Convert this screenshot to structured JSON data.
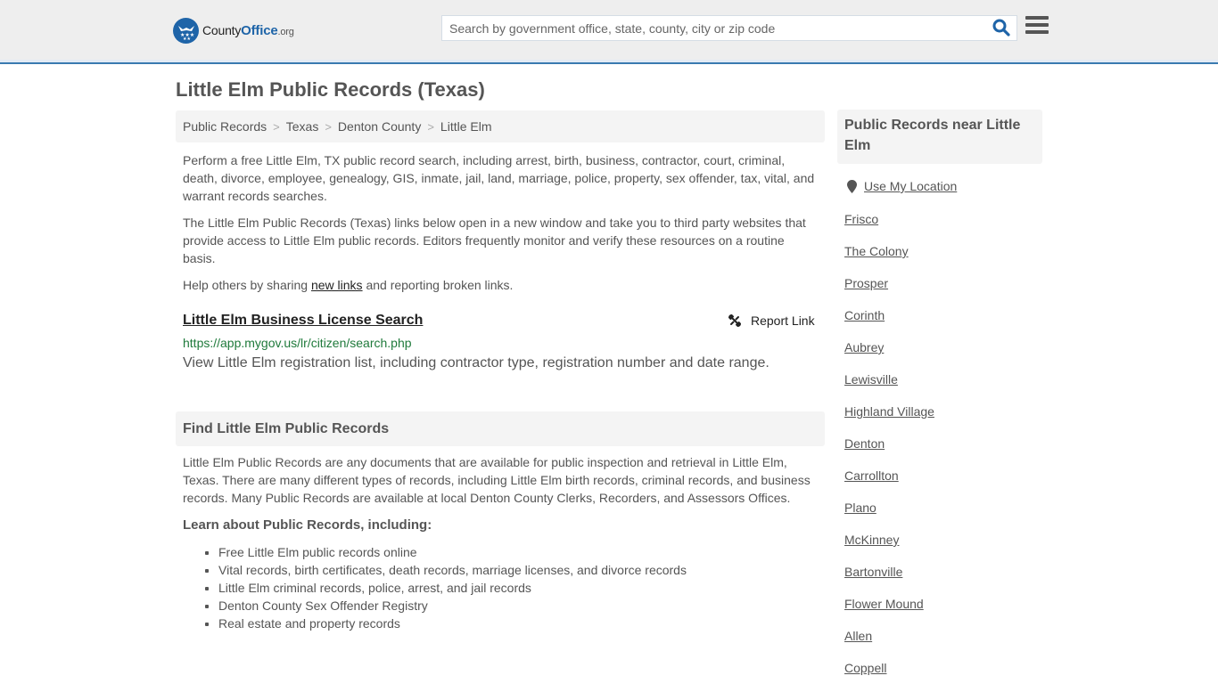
{
  "header": {
    "logo": {
      "name_main": "County",
      "name_accent": "Office",
      "name_suffix": ".org"
    },
    "search": {
      "placeholder": "Search by government office, state, county, city or zip code",
      "value": ""
    },
    "colors": {
      "brand": "#1e64a8",
      "accent_border": "#3a7ab0",
      "url_green": "#1f7a3b"
    }
  },
  "page": {
    "title": "Little Elm Public Records (Texas)",
    "breadcrumb": [
      "Public Records",
      "Texas",
      "Denton County",
      "Little Elm"
    ],
    "intro": "Perform a free Little Elm, TX public record search, including arrest, birth, business, contractor, court, criminal, death, divorce, employee, genealogy, GIS, inmate, jail, land, marriage, police, property, sex offender, tax, vital, and warrant records searches.",
    "disclaimer": "The Little Elm Public Records (Texas) links below open in a new window and take you to third party websites that provide access to Little Elm public records. Editors frequently monitor and verify these resources on a routine basis.",
    "help": {
      "before": "Help others by sharing ",
      "link": "new links",
      "after": " and reporting broken links."
    }
  },
  "records": [
    {
      "title": "Little Elm Business License Search",
      "url": "https://app.mygov.us/lr/citizen/search.php",
      "description": "View Little Elm registration list, including contractor type, registration number and date range.",
      "report_label": "Report Link"
    }
  ],
  "find_section": {
    "heading": "Find Little Elm Public Records",
    "body": "Little Elm Public Records are any documents that are available for public inspection and retrieval in Little Elm, Texas. There are many different types of records, including Little Elm birth records, criminal records, and business records. Many Public Records are available at local Denton County Clerks, Recorders, and Assessors Offices.",
    "learn_heading": "Learn about Public Records, including:",
    "learn_items": [
      "Free Little Elm public records online",
      "Vital records, birth certificates, death records, marriage licenses, and divorce records",
      "Little Elm criminal records, police, arrest, and jail records",
      "Denton County Sex Offender Registry",
      "Real estate and property records"
    ]
  },
  "sidebar": {
    "heading": "Public Records near Little Elm",
    "use_location": "Use My Location",
    "nearby": [
      "Frisco",
      "The Colony",
      "Prosper",
      "Corinth",
      "Aubrey",
      "Lewisville",
      "Highland Village",
      "Denton",
      "Carrollton",
      "Plano",
      "McKinney",
      "Bartonville",
      "Flower Mound",
      "Allen",
      "Coppell"
    ]
  }
}
